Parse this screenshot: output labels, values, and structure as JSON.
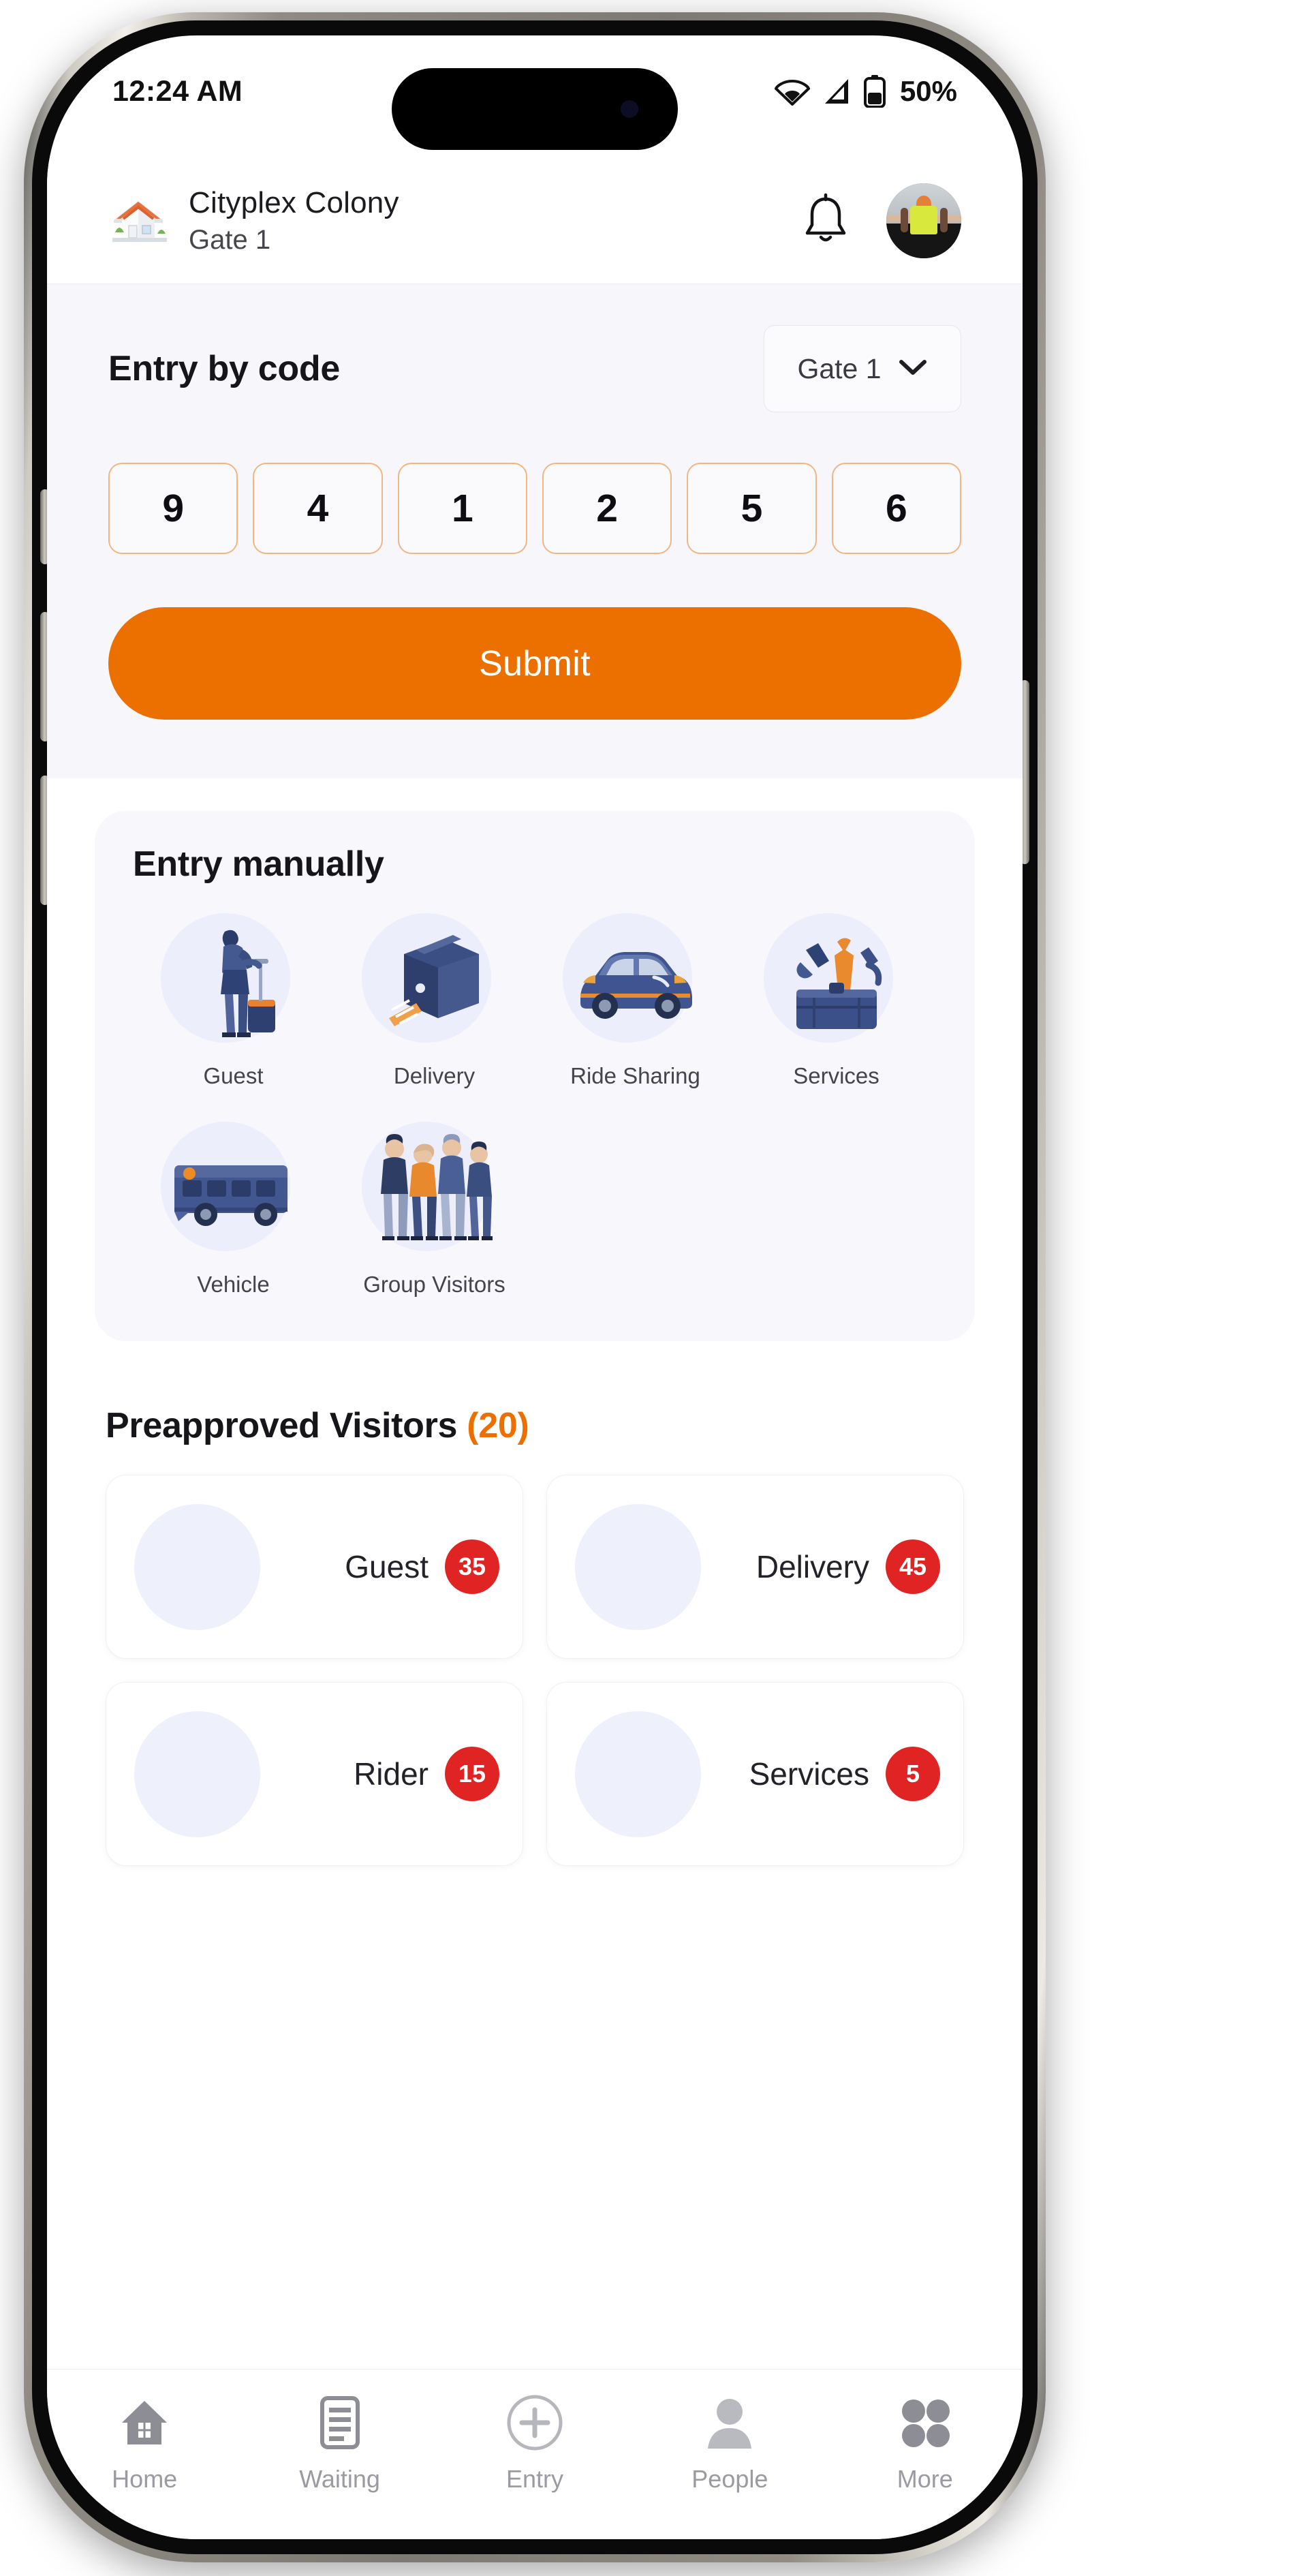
{
  "status_bar": {
    "time": "12:24 AM",
    "battery_percent": "50%",
    "icons": [
      "wifi-icon",
      "cellular-signal-icon",
      "battery-icon"
    ]
  },
  "header": {
    "society_name": "Cityplex Colony",
    "gate_name": "Gate 1",
    "home_icon": "house-icon",
    "notification_icon": "bell-icon",
    "avatar": "user-avatar"
  },
  "entry_by_code": {
    "title": "Entry by code",
    "gate_selector": {
      "value": "Gate 1",
      "chevron": "chevron-down-icon"
    },
    "code_digits": [
      "9",
      "4",
      "1",
      "2",
      "5",
      "6"
    ],
    "submit_label": "Submit"
  },
  "entry_manually": {
    "title": "Entry manually",
    "items": [
      {
        "label": "Guest",
        "icon": "guest-traveler-icon"
      },
      {
        "label": "Delivery",
        "icon": "delivery-box-icon"
      },
      {
        "label": "Ride Sharing",
        "icon": "car-icon"
      },
      {
        "label": "Services",
        "icon": "toolbox-icon"
      },
      {
        "label": "Vehicle",
        "icon": "bus-icon"
      },
      {
        "label": "Group Visitors",
        "icon": "group-people-icon"
      }
    ]
  },
  "preapproved": {
    "title": "Preapproved Visitors",
    "count": "(20)",
    "cards": [
      {
        "label": "Guest",
        "badge": "35",
        "icon": "guest-traveler-icon"
      },
      {
        "label": "Delivery",
        "badge": "45",
        "icon": "delivery-box-icon"
      },
      {
        "label": "Rider",
        "badge": "15",
        "icon": "car-icon"
      },
      {
        "label": "Services",
        "badge": "5",
        "icon": "toolbox-icon"
      }
    ]
  },
  "bottom_nav": {
    "items": [
      {
        "label": "Home",
        "icon": "home-icon"
      },
      {
        "label": "Waiting",
        "icon": "clipboard-list-icon"
      },
      {
        "label": "Entry",
        "icon": "plus-circle-icon"
      },
      {
        "label": "People",
        "icon": "person-icon"
      },
      {
        "label": "More",
        "icon": "grid-dots-icon"
      }
    ]
  },
  "colors": {
    "accent_orange": "#EC7000",
    "badge_red": "#E02424",
    "panel_bg": "#F7F7FB",
    "icon_blue": "#3D538F"
  }
}
